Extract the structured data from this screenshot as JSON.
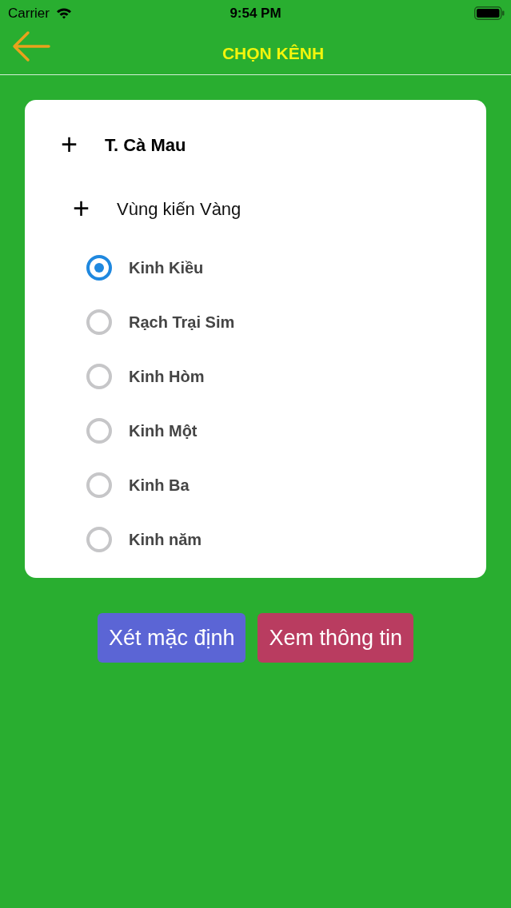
{
  "status_bar": {
    "carrier": "Carrier",
    "time": "9:54 PM"
  },
  "nav_bar": {
    "title": "CHỌN KÊNH"
  },
  "tree": [
    {
      "kind": "group",
      "toggle": "+",
      "label": "T. Cà Mau",
      "children": [
        {
          "kind": "group",
          "toggle": "+",
          "label": "Vùng kiến Vàng",
          "children": [
            {
              "kind": "option",
              "label": "Kinh Kiều",
              "selected": true
            },
            {
              "kind": "option",
              "label": "Rạch Trại Sim",
              "selected": false
            },
            {
              "kind": "option",
              "label": "Kinh Hòm",
              "selected": false
            },
            {
              "kind": "option",
              "label": "Kinh Một",
              "selected": false
            },
            {
              "kind": "option",
              "label": "Kinh Ba",
              "selected": false
            },
            {
              "kind": "option",
              "label": "Kinh năm",
              "selected": false
            }
          ]
        }
      ]
    }
  ],
  "buttons": [
    {
      "label": "Xét mặc định",
      "color": "#5b65d5"
    },
    {
      "label": "Xem thông tin",
      "color": "#b93c60"
    }
  ]
}
